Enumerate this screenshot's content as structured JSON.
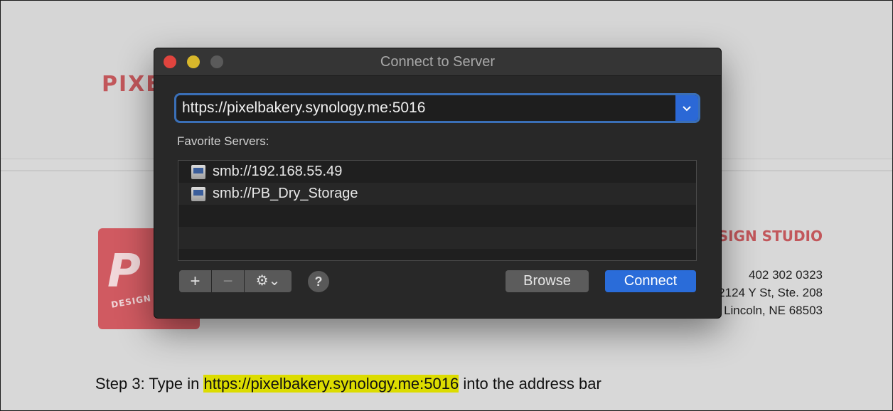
{
  "background": {
    "logo_text": "PIXE",
    "logo_sub": "DESIGN",
    "studio": "SIGN STUDIO",
    "phone": "402 302 0323",
    "address_line1": "2124 Y St, Ste. 208",
    "address_line2": "Lincoln, NE 68503"
  },
  "dialog": {
    "title": "Connect to Server",
    "address_value": "https://pixelbakery.synology.me:5016",
    "favorites_label": "Favorite Servers:",
    "favorites": [
      "smb://192.168.55.49",
      "smb://PB_Dry_Storage"
    ],
    "toolbar": {
      "add_label": "+",
      "remove_label": "−",
      "gear_label": "⚙⌄",
      "help_label": "?"
    },
    "browse_label": "Browse",
    "connect_label": "Connect"
  },
  "caption": {
    "prefix": "Step 3: Type in ",
    "highlight": "https://pixelbakery.synology.me:5016",
    "suffix": " into the address bar"
  },
  "colors": {
    "accent": "#2a6cd9",
    "brand": "#d05a61",
    "highlight": "#dcdc00"
  }
}
